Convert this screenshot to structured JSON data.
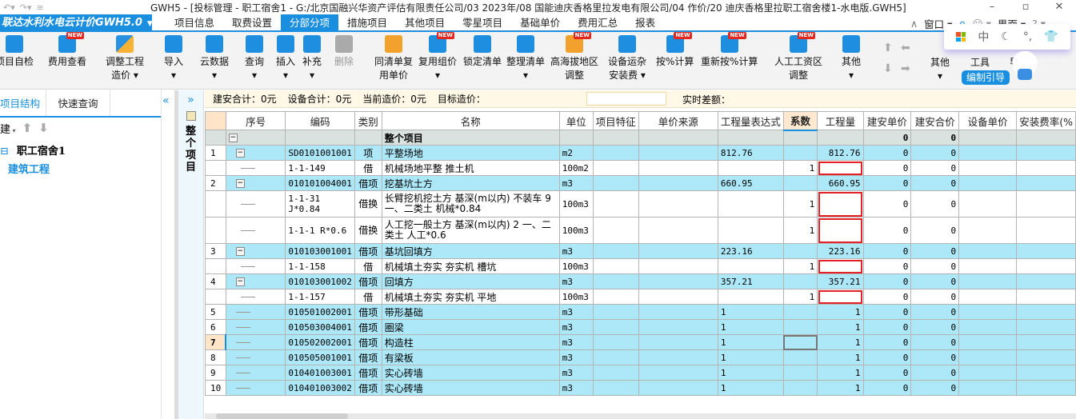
{
  "window": {
    "title": "GWH5 - [投标管理 - 职工宿舍1 - G:/北京国融兴华资产评估有限责任公司/03 2023年/08 国能迪庆香格里拉发电有限公司/04 作价/20  迪庆香格里拉职工宿舍楼1-水电版.GWH5]",
    "controls": [
      "–",
      "▫",
      "✕"
    ]
  },
  "menubar": {
    "brand": "联达水利水电云计价GWH5.0",
    "tabs": [
      "项目信息",
      "取费设置",
      "分部分项",
      "措施项目",
      "其他项目",
      "零星项目",
      "基础单价",
      "费用汇总",
      "报表"
    ],
    "active_tab": "分部分项",
    "right": {
      "window_label": "窗口",
      "ui_label": "界面"
    }
  },
  "toolbar": {
    "buttons": [
      {
        "label": "项目自检",
        "sub": ""
      },
      {
        "label": "费用查看",
        "sub": "",
        "new": true
      },
      {
        "label": "调整工程",
        "sub": "造价 ▾"
      },
      {
        "label": "导入",
        "sub": "▾"
      },
      {
        "label": "云数据",
        "sub": "▾"
      },
      {
        "label": "查询",
        "sub": "▾"
      },
      {
        "label": "插入",
        "sub": "▾"
      },
      {
        "label": "补充",
        "sub": "▾"
      },
      {
        "label": "删除",
        "sub": "",
        "disabled": true
      },
      {
        "label": "同清单复",
        "sub": "用单价"
      },
      {
        "label": "复用组价",
        "sub": "▾",
        "new": true
      },
      {
        "label": "锁定清单",
        "sub": ""
      },
      {
        "label": "整理清单",
        "sub": "▾"
      },
      {
        "label": "高海拔地区",
        "sub": "调整",
        "new": true
      },
      {
        "label": "设备运杂",
        "sub": "安装费 ▾"
      },
      {
        "label": "按%计算",
        "sub": "",
        "new": true
      },
      {
        "label": "重新按%计算",
        "sub": "",
        "new": true
      },
      {
        "label": "人工工资区",
        "sub": "调整",
        "new": true
      },
      {
        "label": "其他",
        "sub": "▾"
      },
      {
        "label": "其他",
        "sub": "▾"
      },
      {
        "label": "工具",
        "sub": ""
      },
      {
        "label": "导",
        "sub": ""
      }
    ],
    "guide_label": "编制引导",
    "ime": {
      "mode": "中"
    }
  },
  "leftpanel": {
    "tabs": [
      "项目结构",
      "快速查询"
    ],
    "active_tab": "项目结构",
    "new_label": "建",
    "tree": {
      "root": "职工宿舍1",
      "child": "建筑工程"
    }
  },
  "sidestrip": {
    "label": "整个项目"
  },
  "summary": {
    "jianan_total": "建安合计：0元",
    "equip_total": "设备合计：0元",
    "current_price": "当前造价：0元",
    "target_label": "目标造价：",
    "target_value": "",
    "realtime_diff": "实时差额："
  },
  "grid": {
    "columns": [
      "序号",
      "编码",
      "类别",
      "名称",
      "单位",
      "项目特征",
      "单价来源",
      "工程量表达式",
      "系数",
      "工程量",
      "建安单价",
      "建安合价",
      "设备单价",
      "安装费率(%"
    ],
    "selected_column": "系数",
    "rows": [
      {
        "type": "root",
        "rn": "",
        "code": "",
        "cat": "",
        "name": "整个项目",
        "unit": "",
        "expr": "",
        "coef": "",
        "qty": "",
        "up": "0",
        "tp": "0",
        "expand": true
      },
      {
        "type": "qd",
        "rn": "1",
        "code": "SD0101001001",
        "cat": "项",
        "name": "平整场地",
        "unit": "m2",
        "expr": "812.76",
        "coef": "",
        "qty": "812.76",
        "up": "0",
        "tp": "0",
        "expand": true
      },
      {
        "type": "de",
        "rn": "",
        "code": "1-1-149",
        "cat": "借",
        "name": "机械场地平整 推土机",
        "unit": "100m2",
        "expr": "",
        "coef": "1",
        "qty": "",
        "up": "0",
        "tp": "0",
        "highlight": true
      },
      {
        "type": "qd",
        "rn": "2",
        "code": "010101004001",
        "cat": "借项",
        "name": "挖基坑土方",
        "unit": "m3",
        "expr": "660.95",
        "coef": "",
        "qty": "660.95",
        "up": "0",
        "tp": "0",
        "expand": true
      },
      {
        "type": "de",
        "rn": "",
        "code": "1-1-31 J*0.84",
        "cat": "借换",
        "name": "长臂挖机挖土方 基深(m以内) 不装车 9 一、二类土 机械*0.84",
        "unit": "100m3",
        "expr": "",
        "coef": "1",
        "qty": "",
        "up": "0",
        "tp": "0",
        "tall": true,
        "highlight": true
      },
      {
        "type": "de",
        "rn": "",
        "code": "1-1-1 R*0.6",
        "cat": "借换",
        "name": "人工挖一般土方 基深(m以内) 2  一、二类土 人工*0.6",
        "unit": "100m3",
        "expr": "",
        "coef": "1",
        "qty": "",
        "up": "0",
        "tp": "0",
        "tall": true,
        "highlight": true
      },
      {
        "type": "qd",
        "rn": "3",
        "code": "010103001001",
        "cat": "借项",
        "name": "基坑回填方",
        "unit": "m3",
        "expr": "223.16",
        "coef": "",
        "qty": "223.16",
        "up": "0",
        "tp": "0",
        "expand": true
      },
      {
        "type": "de",
        "rn": "",
        "code": "1-1-158",
        "cat": "借",
        "name": "机械填土夯实 夯实机 槽坑",
        "unit": "100m3",
        "expr": "",
        "coef": "1",
        "qty": "",
        "up": "0",
        "tp": "0",
        "highlight": true
      },
      {
        "type": "qd",
        "rn": "4",
        "code": "010103001002",
        "cat": "借项",
        "name": "回填方",
        "unit": "m3",
        "expr": "357.21",
        "coef": "",
        "qty": "357.21",
        "up": "0",
        "tp": "0",
        "expand": true
      },
      {
        "type": "de",
        "rn": "",
        "code": "1-1-157",
        "cat": "借",
        "name": "机械填土夯实 夯实机 平地",
        "unit": "100m3",
        "expr": "",
        "coef": "1",
        "qty": "",
        "up": "0",
        "tp": "0",
        "highlight": true
      },
      {
        "type": "qd",
        "rn": "5",
        "code": "010501002001",
        "cat": "借项",
        "name": "带形基础",
        "unit": "m3",
        "expr": "1",
        "coef": "",
        "qty": "1",
        "up": "0",
        "tp": "0"
      },
      {
        "type": "qd",
        "rn": "6",
        "code": "010503004001",
        "cat": "借项",
        "name": "圈梁",
        "unit": "m3",
        "expr": "1",
        "coef": "",
        "qty": "1",
        "up": "0",
        "tp": "0"
      },
      {
        "type": "qd",
        "rn": "7",
        "code": "010502002001",
        "cat": "借项",
        "name": "构造柱",
        "unit": "m3",
        "expr": "1",
        "coef": "",
        "qty": "1",
        "up": "0",
        "tp": "0",
        "current": true
      },
      {
        "type": "qd",
        "rn": "8",
        "code": "010505001001",
        "cat": "借项",
        "name": "有梁板",
        "unit": "m3",
        "expr": "1",
        "coef": "",
        "qty": "1",
        "up": "0",
        "tp": "0"
      },
      {
        "type": "qd",
        "rn": "9",
        "code": "010401003001",
        "cat": "借项",
        "name": "实心砖墙",
        "unit": "m3",
        "expr": "1",
        "coef": "",
        "qty": "1",
        "up": "0",
        "tp": "0"
      },
      {
        "type": "qd",
        "rn": "10",
        "code": "010401003002",
        "cat": "借项",
        "name": "实心砖墙",
        "unit": "m3",
        "expr": "1",
        "coef": "",
        "qty": "1",
        "up": "0",
        "tp": "0"
      }
    ]
  },
  "colors": {
    "accent": "#1a8fe0",
    "row_bill": "#ade8f8",
    "row_root": "#d9e2df",
    "highlight_box": "#e32129",
    "summary_bg": "#fff8e6"
  }
}
